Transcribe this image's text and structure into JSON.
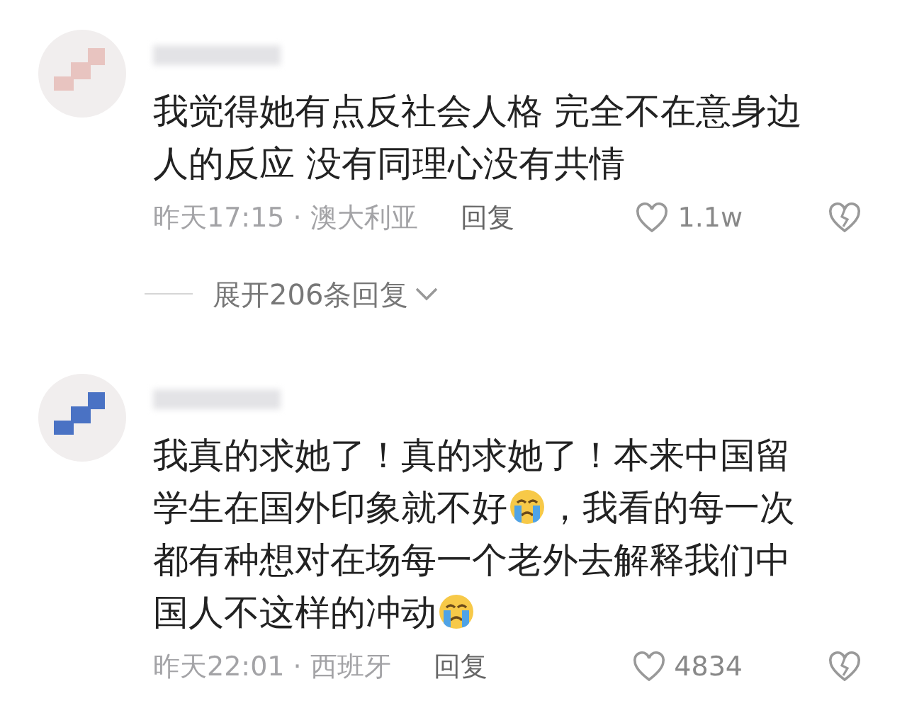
{
  "comments": [
    {
      "avatar": {
        "color": "#e8c4c0"
      },
      "lines": [
        [
          {
            "kind": "text",
            "text": "我觉得她有点反社会人格 完全不在意身边"
          }
        ],
        [
          {
            "kind": "text",
            "text": "人的反应 没有同理心没有共情"
          }
        ]
      ],
      "time": "昨天17:15",
      "location": "· 澳大利亚",
      "reply": "回复",
      "likes": "1.1w",
      "replies": "展开206条回复"
    },
    {
      "avatar": {
        "color": "#4a72c4"
      },
      "lines": [
        [
          {
            "kind": "text",
            "text": "我真的求她了！真的求她了！本来中国留"
          }
        ],
        [
          {
            "kind": "text",
            "text": "学生在国外印象就不好"
          },
          {
            "kind": "emoji"
          },
          {
            "kind": "text",
            "text": "，我看的每一次"
          }
        ],
        [
          {
            "kind": "text",
            "text": "都有种想对在场每一个老外去解释我们中"
          }
        ],
        [
          {
            "kind": "text",
            "text": "国人不这样的冲动"
          },
          {
            "kind": "emoji"
          }
        ]
      ],
      "time": "昨天22:01",
      "location": "· 西班牙",
      "reply": "回复",
      "likes": "4834"
    }
  ]
}
